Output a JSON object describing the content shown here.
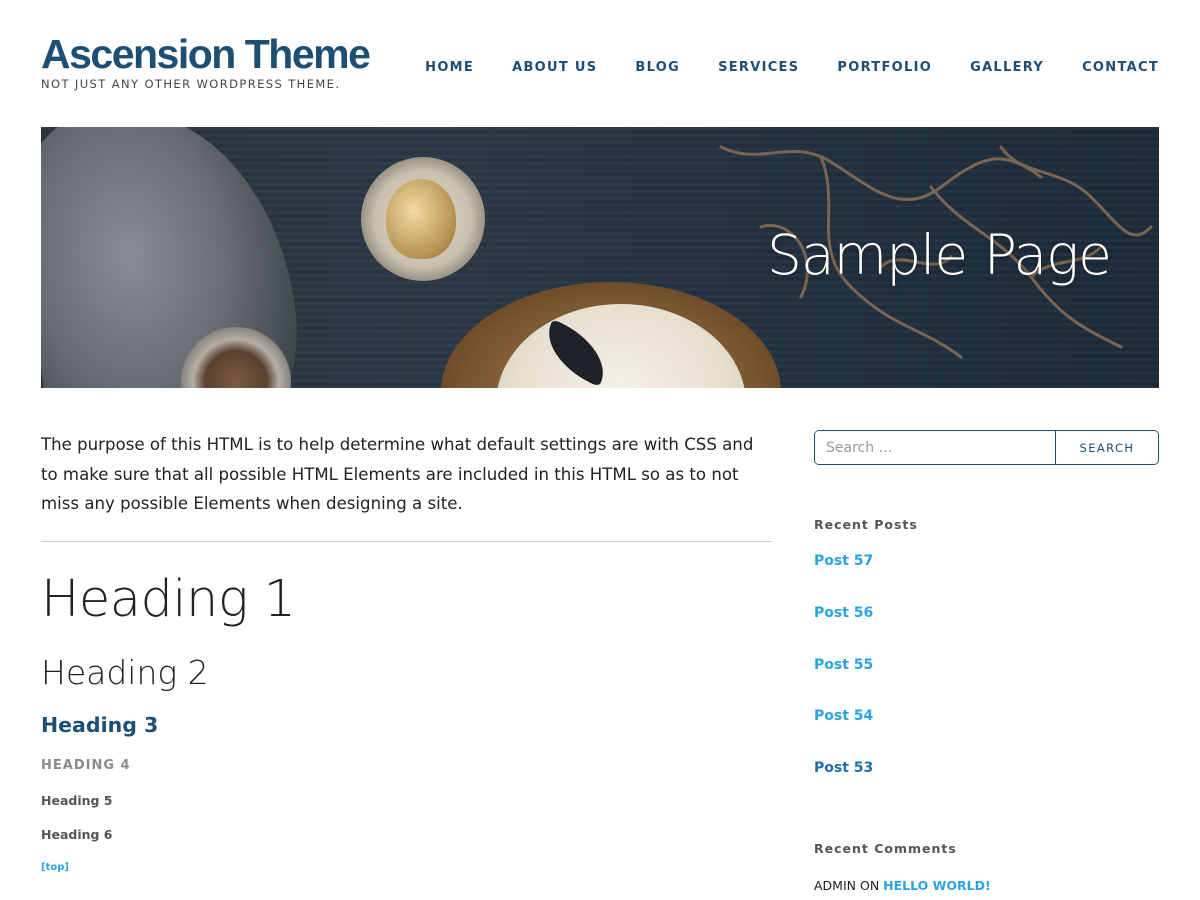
{
  "header": {
    "site_title": "Ascension Theme",
    "tagline": "Not just any other WordPress Theme."
  },
  "nav": {
    "items": [
      {
        "label": "Home"
      },
      {
        "label": "About Us"
      },
      {
        "label": "Blog"
      },
      {
        "label": "Services"
      },
      {
        "label": "Portfolio"
      },
      {
        "label": "Gallery"
      },
      {
        "label": "Contact"
      }
    ]
  },
  "hero": {
    "title": "Sample Page"
  },
  "content": {
    "intro": "The purpose of this HTML is to help determine what default settings are with CSS and to make sure that all possible HTML Elements are included in this HTML so as to not miss any possible Elements when designing a site.",
    "heading1": "Heading 1",
    "heading2": "Heading 2",
    "heading3": "Heading 3",
    "heading4": "Heading 4",
    "heading5": "Heading 5",
    "heading6": "Heading 6",
    "top_link": "[top]"
  },
  "sidebar": {
    "search": {
      "placeholder": "Search …",
      "button_label": "Search"
    },
    "recent_posts": {
      "title": "Recent Posts",
      "items": [
        {
          "label": "Post 57"
        },
        {
          "label": "Post 56"
        },
        {
          "label": "Post 55"
        },
        {
          "label": "Post 54"
        },
        {
          "label": "Post 53"
        }
      ]
    },
    "recent_comments": {
      "title": "Recent Comments",
      "author": "admin",
      "on_text": "on",
      "post_link": "Hello world!"
    }
  },
  "colors": {
    "brand_navy": "#1d4e74",
    "link_blue": "#2aa4e0"
  }
}
